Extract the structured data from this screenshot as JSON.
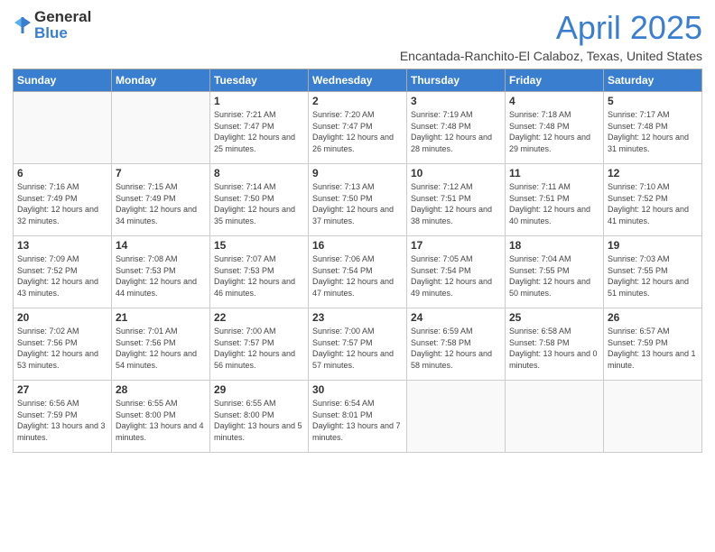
{
  "header": {
    "logo_general": "General",
    "logo_blue": "Blue",
    "title": "April 2025",
    "subtitle": "Encantada-Ranchito-El Calaboz, Texas, United States"
  },
  "weekdays": [
    "Sunday",
    "Monday",
    "Tuesday",
    "Wednesday",
    "Thursday",
    "Friday",
    "Saturday"
  ],
  "weeks": [
    [
      {
        "day": "",
        "info": ""
      },
      {
        "day": "",
        "info": ""
      },
      {
        "day": "1",
        "info": "Sunrise: 7:21 AM\nSunset: 7:47 PM\nDaylight: 12 hours and 25 minutes."
      },
      {
        "day": "2",
        "info": "Sunrise: 7:20 AM\nSunset: 7:47 PM\nDaylight: 12 hours and 26 minutes."
      },
      {
        "day": "3",
        "info": "Sunrise: 7:19 AM\nSunset: 7:48 PM\nDaylight: 12 hours and 28 minutes."
      },
      {
        "day": "4",
        "info": "Sunrise: 7:18 AM\nSunset: 7:48 PM\nDaylight: 12 hours and 29 minutes."
      },
      {
        "day": "5",
        "info": "Sunrise: 7:17 AM\nSunset: 7:48 PM\nDaylight: 12 hours and 31 minutes."
      }
    ],
    [
      {
        "day": "6",
        "info": "Sunrise: 7:16 AM\nSunset: 7:49 PM\nDaylight: 12 hours and 32 minutes."
      },
      {
        "day": "7",
        "info": "Sunrise: 7:15 AM\nSunset: 7:49 PM\nDaylight: 12 hours and 34 minutes."
      },
      {
        "day": "8",
        "info": "Sunrise: 7:14 AM\nSunset: 7:50 PM\nDaylight: 12 hours and 35 minutes."
      },
      {
        "day": "9",
        "info": "Sunrise: 7:13 AM\nSunset: 7:50 PM\nDaylight: 12 hours and 37 minutes."
      },
      {
        "day": "10",
        "info": "Sunrise: 7:12 AM\nSunset: 7:51 PM\nDaylight: 12 hours and 38 minutes."
      },
      {
        "day": "11",
        "info": "Sunrise: 7:11 AM\nSunset: 7:51 PM\nDaylight: 12 hours and 40 minutes."
      },
      {
        "day": "12",
        "info": "Sunrise: 7:10 AM\nSunset: 7:52 PM\nDaylight: 12 hours and 41 minutes."
      }
    ],
    [
      {
        "day": "13",
        "info": "Sunrise: 7:09 AM\nSunset: 7:52 PM\nDaylight: 12 hours and 43 minutes."
      },
      {
        "day": "14",
        "info": "Sunrise: 7:08 AM\nSunset: 7:53 PM\nDaylight: 12 hours and 44 minutes."
      },
      {
        "day": "15",
        "info": "Sunrise: 7:07 AM\nSunset: 7:53 PM\nDaylight: 12 hours and 46 minutes."
      },
      {
        "day": "16",
        "info": "Sunrise: 7:06 AM\nSunset: 7:54 PM\nDaylight: 12 hours and 47 minutes."
      },
      {
        "day": "17",
        "info": "Sunrise: 7:05 AM\nSunset: 7:54 PM\nDaylight: 12 hours and 49 minutes."
      },
      {
        "day": "18",
        "info": "Sunrise: 7:04 AM\nSunset: 7:55 PM\nDaylight: 12 hours and 50 minutes."
      },
      {
        "day": "19",
        "info": "Sunrise: 7:03 AM\nSunset: 7:55 PM\nDaylight: 12 hours and 51 minutes."
      }
    ],
    [
      {
        "day": "20",
        "info": "Sunrise: 7:02 AM\nSunset: 7:56 PM\nDaylight: 12 hours and 53 minutes."
      },
      {
        "day": "21",
        "info": "Sunrise: 7:01 AM\nSunset: 7:56 PM\nDaylight: 12 hours and 54 minutes."
      },
      {
        "day": "22",
        "info": "Sunrise: 7:00 AM\nSunset: 7:57 PM\nDaylight: 12 hours and 56 minutes."
      },
      {
        "day": "23",
        "info": "Sunrise: 7:00 AM\nSunset: 7:57 PM\nDaylight: 12 hours and 57 minutes."
      },
      {
        "day": "24",
        "info": "Sunrise: 6:59 AM\nSunset: 7:58 PM\nDaylight: 12 hours and 58 minutes."
      },
      {
        "day": "25",
        "info": "Sunrise: 6:58 AM\nSunset: 7:58 PM\nDaylight: 13 hours and 0 minutes."
      },
      {
        "day": "26",
        "info": "Sunrise: 6:57 AM\nSunset: 7:59 PM\nDaylight: 13 hours and 1 minute."
      }
    ],
    [
      {
        "day": "27",
        "info": "Sunrise: 6:56 AM\nSunset: 7:59 PM\nDaylight: 13 hours and 3 minutes."
      },
      {
        "day": "28",
        "info": "Sunrise: 6:55 AM\nSunset: 8:00 PM\nDaylight: 13 hours and 4 minutes."
      },
      {
        "day": "29",
        "info": "Sunrise: 6:55 AM\nSunset: 8:00 PM\nDaylight: 13 hours and 5 minutes."
      },
      {
        "day": "30",
        "info": "Sunrise: 6:54 AM\nSunset: 8:01 PM\nDaylight: 13 hours and 7 minutes."
      },
      {
        "day": "",
        "info": ""
      },
      {
        "day": "",
        "info": ""
      },
      {
        "day": "",
        "info": ""
      }
    ]
  ]
}
